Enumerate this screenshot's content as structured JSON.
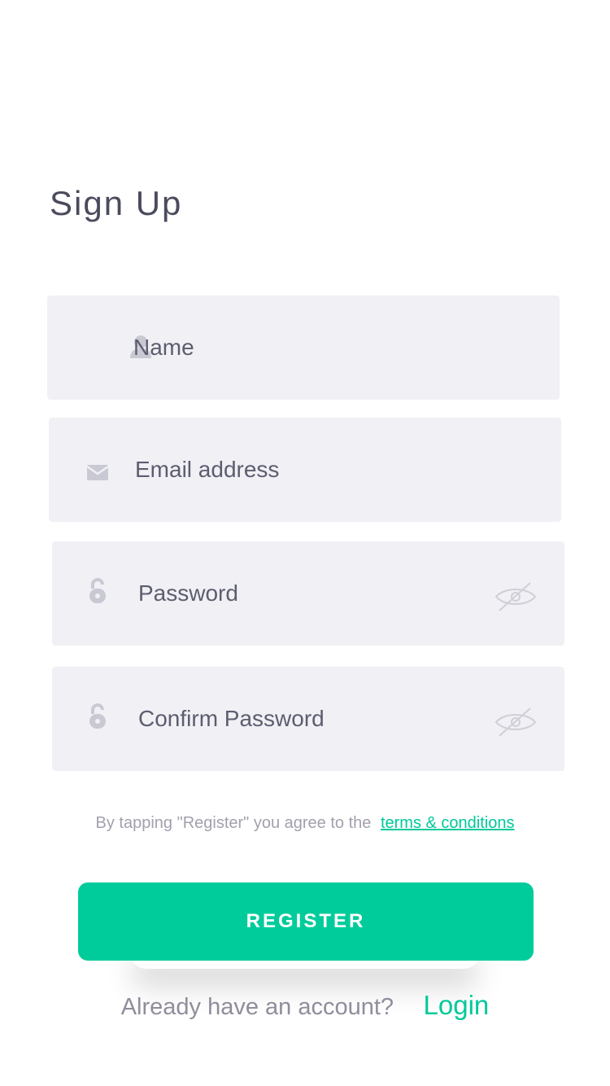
{
  "page": {
    "title": "Sign Up"
  },
  "form": {
    "name": {
      "placeholder": "Name",
      "value": "",
      "icon": "user-icon"
    },
    "email": {
      "placeholder": "Email address",
      "value": "",
      "icon": "envelope-icon"
    },
    "password": {
      "placeholder": "Password",
      "value": "",
      "icon": "lock-icon",
      "toggle_icon": "eye-slash-icon"
    },
    "confirm_password": {
      "placeholder": "Confirm Password",
      "value": "",
      "icon": "lock-icon",
      "toggle_icon": "eye-slash-icon"
    }
  },
  "terms": {
    "text": "By tapping \"Register\" you agree to the",
    "link_label": "terms & conditions"
  },
  "actions": {
    "register_label": "REGISTER",
    "login_prompt": "Already have an account?",
    "login_label": "Login"
  },
  "colors": {
    "accent": "#00cc9b",
    "field_background": "#f0f0f5",
    "title_text": "#4b4b5e",
    "muted_text": "#a1a1ae"
  }
}
